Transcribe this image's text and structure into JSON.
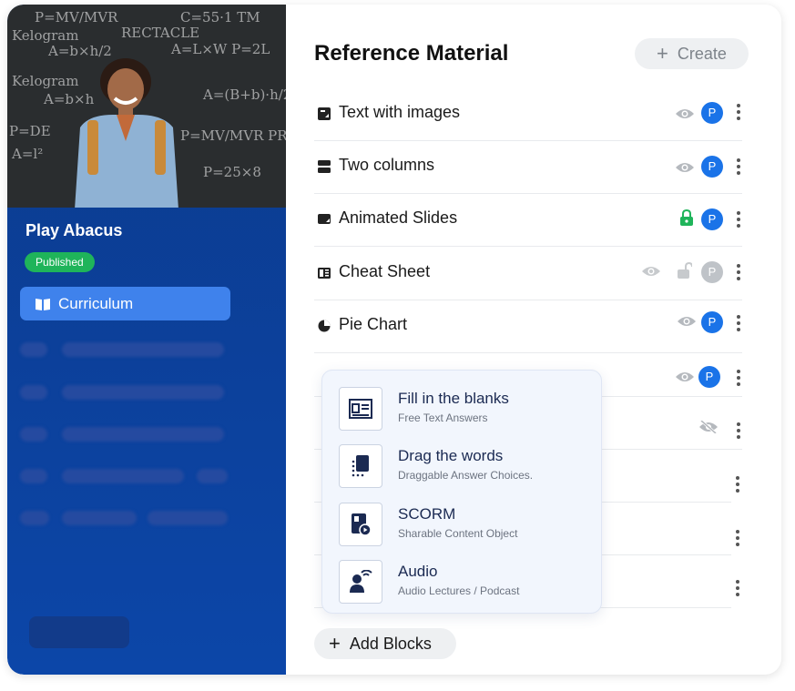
{
  "sidebar": {
    "course_title": "Play Abacus",
    "status_badge": "Published",
    "active_item": "Curriculum"
  },
  "main": {
    "heading": "Reference Material",
    "create_label": "Create",
    "add_blocks_label": "Add Blocks",
    "avatar_initial": "P",
    "rows": [
      {
        "label": "Text with images",
        "icon": "text-image-icon"
      },
      {
        "label": "Two columns",
        "icon": "two-columns-icon"
      },
      {
        "label": "Animated Slides",
        "icon": "slides-icon"
      },
      {
        "label": "Cheat Sheet",
        "icon": "cheat-sheet-icon"
      },
      {
        "label": "Pie Chart",
        "icon": "pie-chart-icon"
      }
    ]
  },
  "block_menu": {
    "options": [
      {
        "title": "Fill in the blanks",
        "subtitle": "Free Text Answers",
        "icon": "fill-blanks-icon"
      },
      {
        "title": "Drag the words",
        "subtitle": "Draggable Answer Choices.",
        "icon": "drag-words-icon"
      },
      {
        "title": "SCORM",
        "subtitle": "Sharable Content Object",
        "icon": "scorm-icon"
      },
      {
        "title": "Audio",
        "subtitle": "Audio Lectures / Podcast",
        "icon": "audio-icon"
      }
    ]
  },
  "colors": {
    "accent": "#1a73e8",
    "published": "#1fb45a",
    "sidebar": "#0c46a8",
    "lock_green": "#1fb45a"
  }
}
